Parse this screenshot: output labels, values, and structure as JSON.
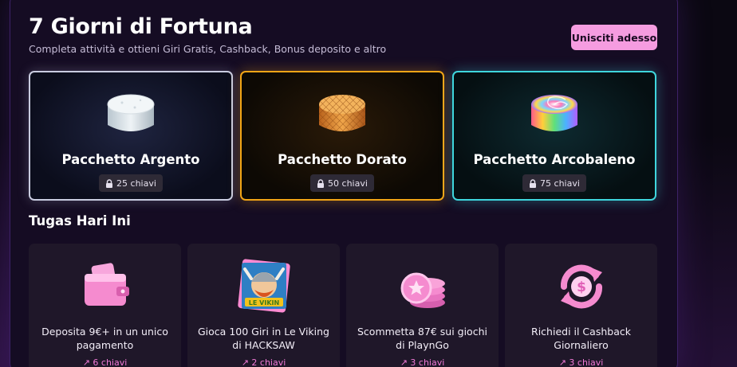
{
  "header": {
    "title": "7 Giorni di Fortuna",
    "subtitle": "Completa attività e ottieni Giri Gratis, Cashback, Bonus deposito e altro",
    "join_label": "Unisciti adesso"
  },
  "packs": [
    {
      "name": "Pacchetto Argento",
      "keys": "25 chiavi",
      "color": "#c9cce0",
      "icon": "silver-cake-icon"
    },
    {
      "name": "Pacchetto Dorato",
      "keys": "50 chiavi",
      "color": "#f2a516",
      "icon": "gold-waffle-cake-icon"
    },
    {
      "name": "Pacchetto Arcobaleno",
      "keys": "75 chiavi",
      "color": "#3fd6dd",
      "icon": "rainbow-candy-icon"
    }
  ],
  "tasks_section": {
    "title": "Tugas Hari Ini"
  },
  "tasks": [
    {
      "text": "Deposita 9€+ in un unico pagamento",
      "reward": "↗ 6 chiavi",
      "icon": "wallet-icon"
    },
    {
      "text": "Gioca 100 Giri in Le Viking di HACKSAW",
      "reward": "↗ 2 chiavi",
      "icon": "le-viking-game-icon"
    },
    {
      "text": "Scommetta 87€ sui giochi di PlaynGo",
      "reward": "↗ 3 chiavi",
      "icon": "coin-stack-icon"
    },
    {
      "text": "Richiedi il Cashback Giornaliero",
      "reward": "↗ 3 chiavi",
      "icon": "cashback-icon"
    }
  ],
  "colors": {
    "accent": "#f59ce0",
    "reward": "#f07ad6",
    "panel": "#150c23"
  }
}
